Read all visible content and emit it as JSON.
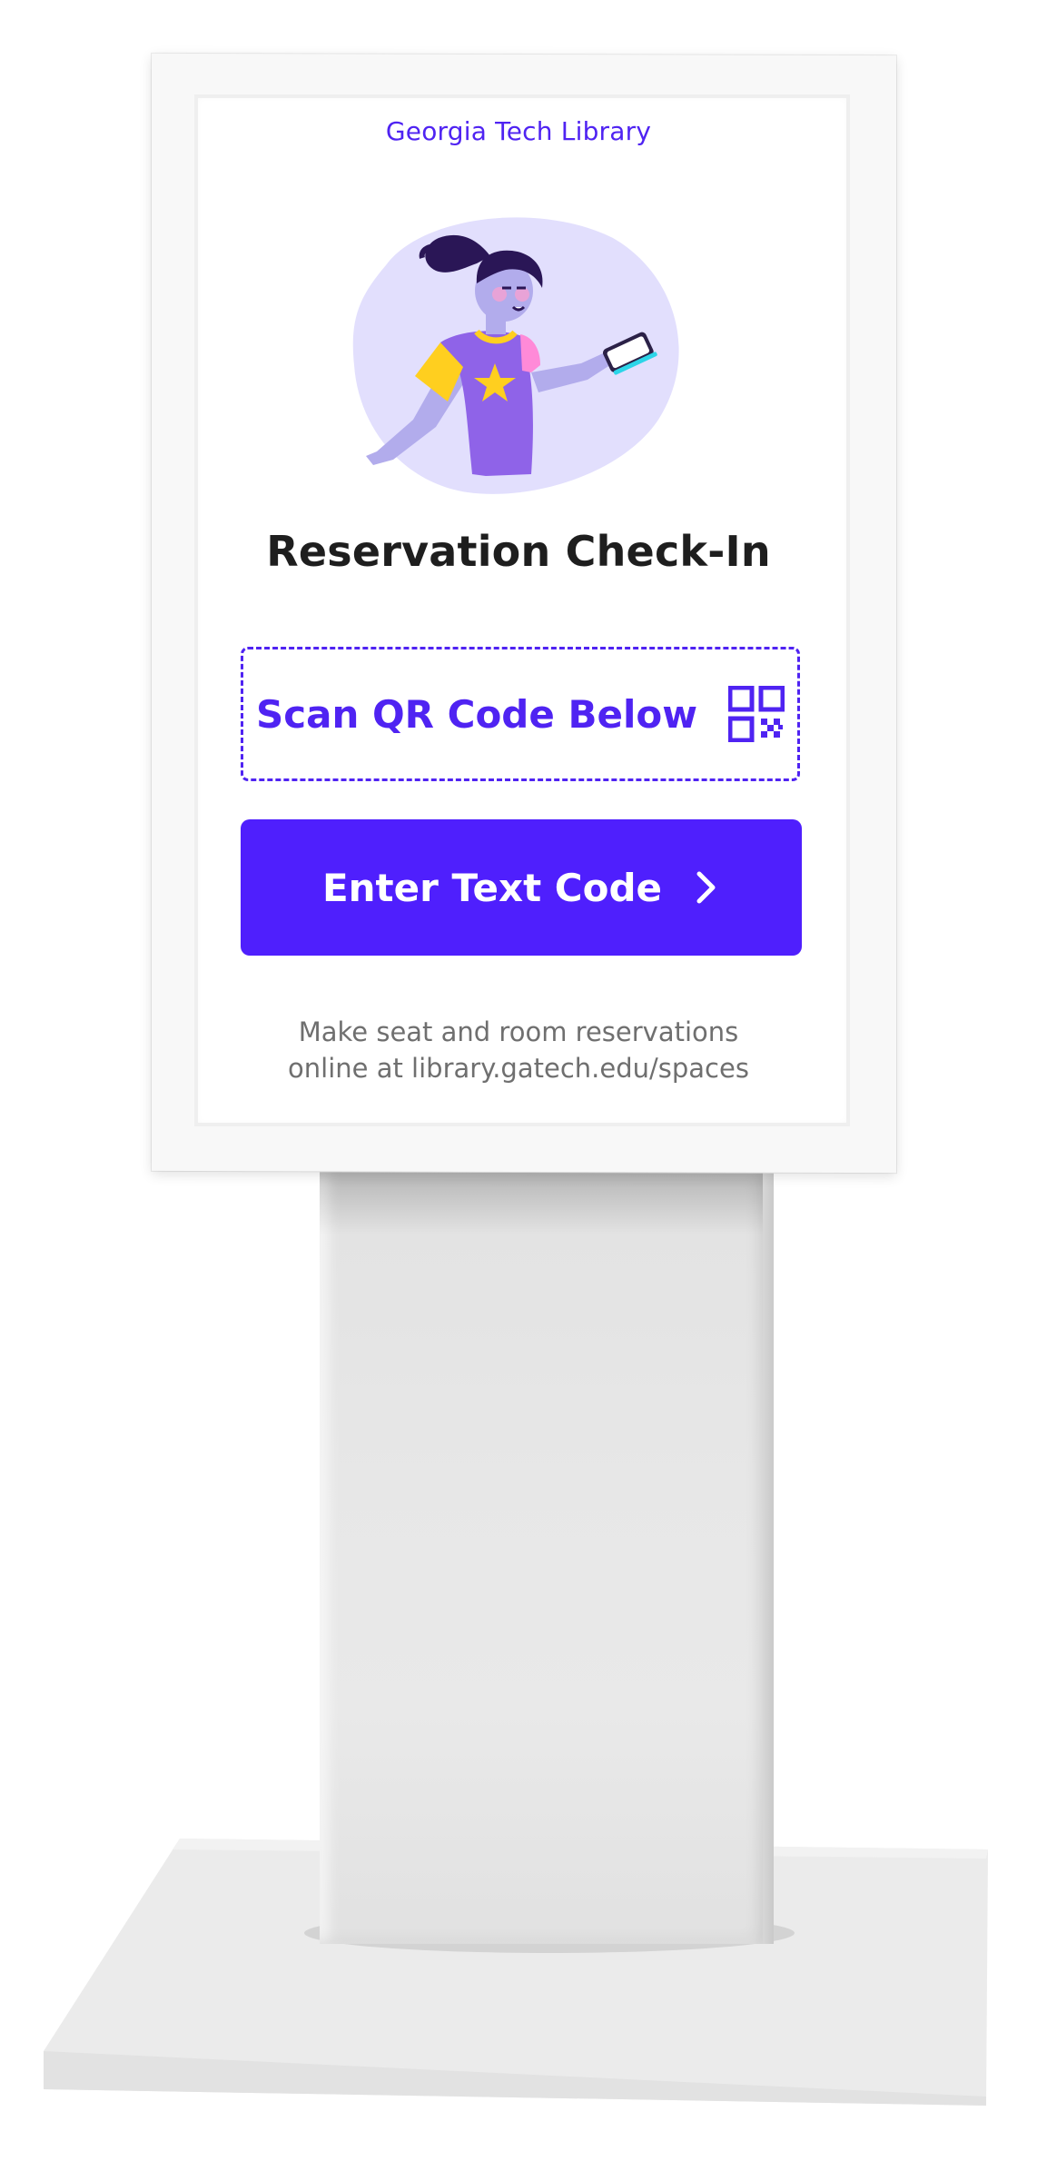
{
  "screen": {
    "brand": "Georgia Tech Library",
    "title": "Reservation Check-In",
    "scan_option": {
      "label": "Scan QR Code Below",
      "icon": "qr-code-icon"
    },
    "text_code_button": {
      "label": "Enter Text Code",
      "icon": "chevron-right-icon"
    },
    "footer": {
      "line1": "Make seat and room reservations",
      "line2": "online at library.gatech.edu/spaces"
    }
  },
  "colors": {
    "accent": "#4F1FFD",
    "title": "#1E1E1E",
    "muted_text": "#6F6F6F",
    "illustration_blob": "#E2DFFD",
    "shirt": "#8F63E8",
    "sleeve": "#FFCF1F"
  }
}
